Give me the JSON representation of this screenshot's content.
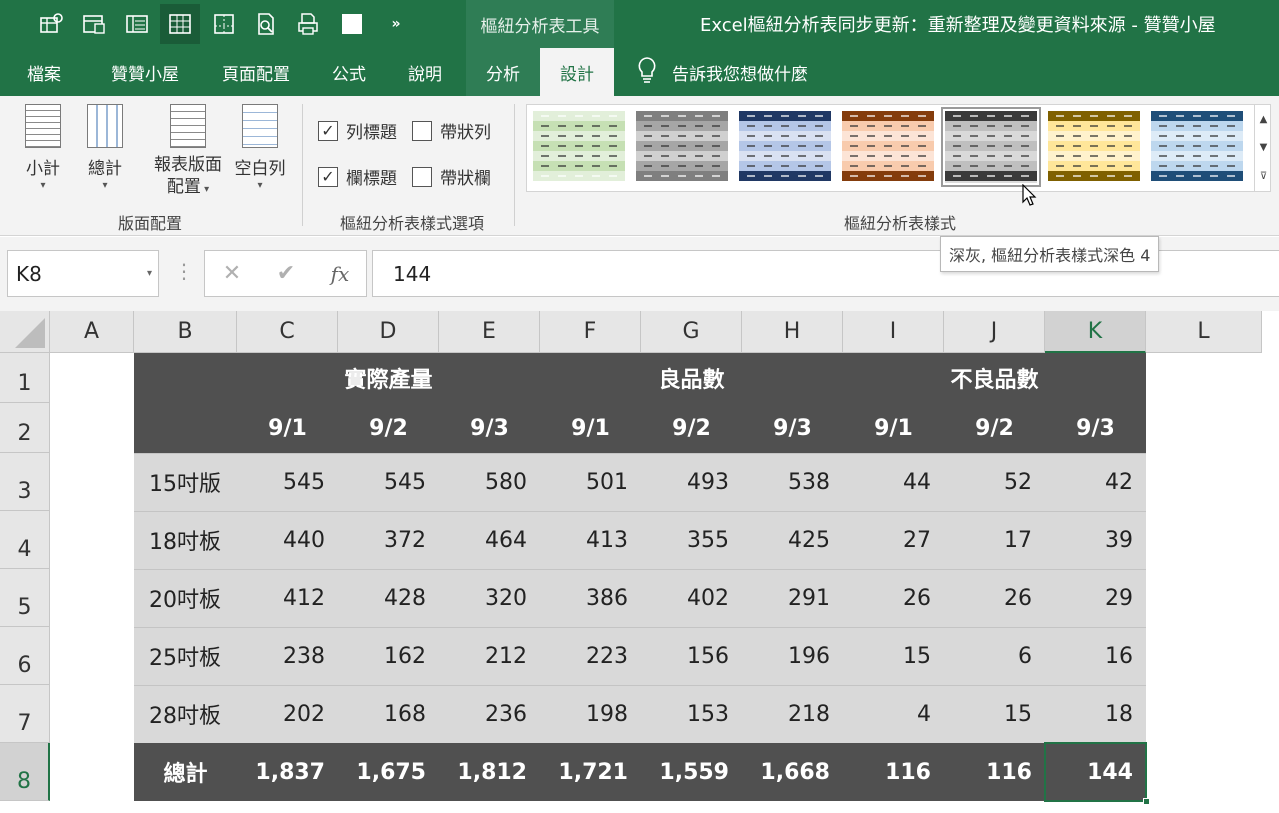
{
  "titlebar": {
    "contextual_tab_group": "樞紐分析表工具",
    "title": "Excel樞紐分析表同步更新：重新整理及變更資料來源  -  贊贊小屋",
    "qat_icons": [
      "pivot-refresh-icon",
      "pivot-layout-icon",
      "field-list-icon",
      "table-grid-icon",
      "layout-icon",
      "print-preview-icon",
      "print-icon",
      "blank-icon",
      "more-icon"
    ]
  },
  "tabs": {
    "file": "檔案",
    "custom": "贊贊小屋",
    "page_layout": "頁面配置",
    "formulas": "公式",
    "help": "說明",
    "analyze": "分析",
    "design": "設計",
    "tell_me": "告訴我您想做什麼"
  },
  "ribbon": {
    "layout_group": {
      "subtotals": "小計",
      "grand_totals": "總計",
      "report_layout_line1": "報表版面",
      "report_layout_line2": "配置",
      "blank_rows": "空白列",
      "label": "版面配置"
    },
    "style_options": {
      "row_headers": "列標題",
      "column_headers": "欄標題",
      "banded_rows": "帶狀列",
      "banded_columns": "帶狀欄",
      "row_headers_checked": true,
      "column_headers_checked": true,
      "banded_rows_checked": false,
      "banded_columns_checked": false,
      "label": "樞紐分析表樣式選項"
    },
    "styles": {
      "label": "樞紐分析表樣式",
      "swatches": [
        {
          "name": "green-light",
          "head": "#e2efda",
          "band": "#c6e0b4",
          "body": "#e2efda"
        },
        {
          "name": "gray-medium",
          "head": "#7f7f7f",
          "band": "#a6a6a6",
          "body": "#d0d0d0"
        },
        {
          "name": "blue-dark",
          "head": "#203864",
          "band": "#b4c6e7",
          "body": "#d9e1f2"
        },
        {
          "name": "orange-dark",
          "head": "#843c0c",
          "band": "#f8cbad",
          "body": "#fce4d6"
        },
        {
          "name": "gray-dark-4",
          "head": "#3a3a3a",
          "band": "#bfbfbf",
          "body": "#d9d9d9",
          "selected": true
        },
        {
          "name": "gold-dark",
          "head": "#7f6000",
          "band": "#ffe699",
          "body": "#fff2cc"
        },
        {
          "name": "navy-dark",
          "head": "#1f4e78",
          "band": "#bdd7ee",
          "body": "#ddebf7"
        }
      ]
    }
  },
  "tooltip": "深灰, 樞紐分析表樣式深色 4",
  "formula_bar": {
    "name_box": "K8",
    "cancel": "✕",
    "enter": "✔",
    "fx": "fx",
    "value": "144"
  },
  "columns": [
    "A",
    "B",
    "C",
    "D",
    "E",
    "F",
    "G",
    "H",
    "I",
    "J",
    "K",
    "L"
  ],
  "rows": [
    "1",
    "2",
    "3",
    "4",
    "5",
    "6",
    "7",
    "8"
  ],
  "pivot": {
    "groups": [
      "實際產量",
      "良品數",
      "不良品數"
    ],
    "dates": [
      "9/1",
      "9/2",
      "9/3",
      "9/1",
      "9/2",
      "9/3",
      "9/1",
      "9/2",
      "9/3"
    ],
    "body": [
      {
        "label": "15吋版",
        "values": [
          "545",
          "545",
          "580",
          "501",
          "493",
          "538",
          "44",
          "52",
          "42"
        ]
      },
      {
        "label": "18吋板",
        "values": [
          "440",
          "372",
          "464",
          "413",
          "355",
          "425",
          "27",
          "17",
          "39"
        ]
      },
      {
        "label": "20吋板",
        "values": [
          "412",
          "428",
          "320",
          "386",
          "402",
          "291",
          "26",
          "26",
          "29"
        ]
      },
      {
        "label": "25吋板",
        "values": [
          "238",
          "162",
          "212",
          "223",
          "156",
          "196",
          "15",
          "6",
          "16"
        ]
      },
      {
        "label": "28吋板",
        "values": [
          "202",
          "168",
          "236",
          "198",
          "153",
          "218",
          "4",
          "15",
          "18"
        ]
      }
    ],
    "total": {
      "label": "總計",
      "values": [
        "1,837",
        "1,675",
        "1,812",
        "1,721",
        "1,559",
        "1,668",
        "116",
        "116",
        "144"
      ]
    }
  },
  "colors": {
    "excel_green": "#217346",
    "pivot_header": "#505050",
    "pivot_body": "#d9d9d9"
  }
}
